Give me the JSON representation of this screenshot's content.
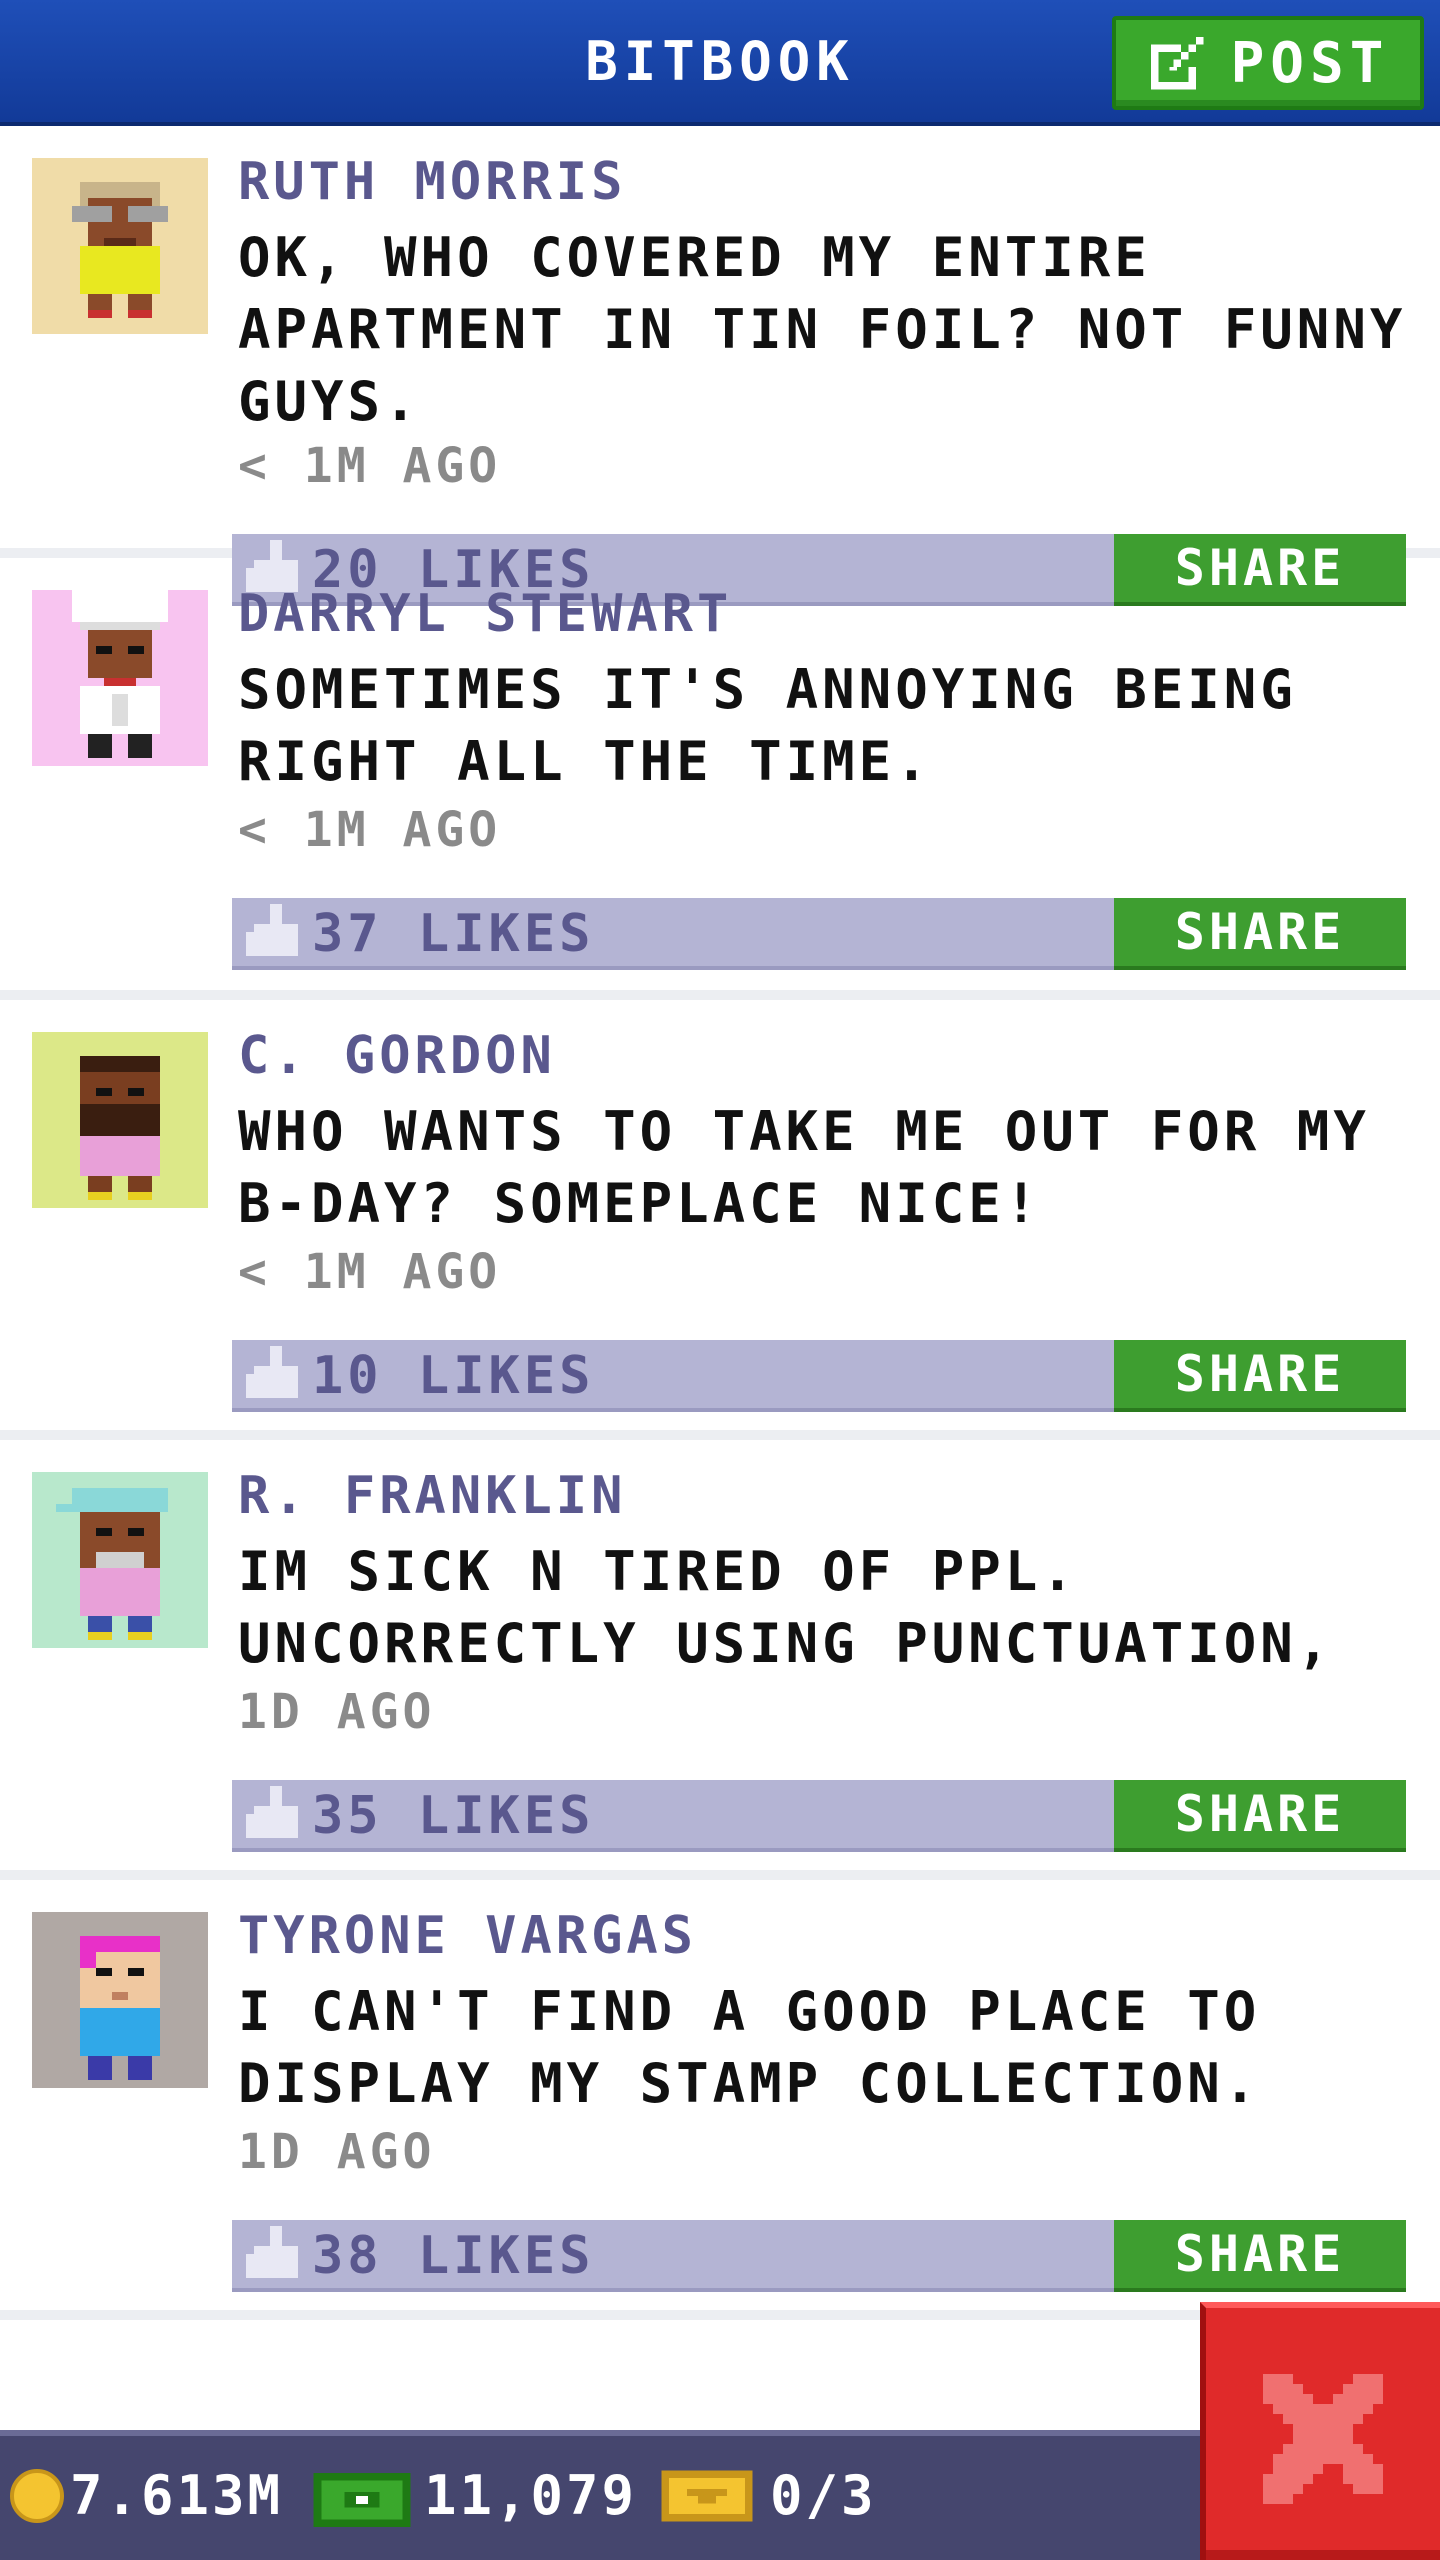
{
  "header": {
    "title": "BITBOOK",
    "post_label": "POST"
  },
  "posts": [
    {
      "name": "RUTH MORRIS",
      "text": "OK, WHO COVERED MY ENTIRE APARTMENT IN TIN FOIL? NOT FUNNY GUYS.",
      "time": "< 1M AGO",
      "likes": "20 LIKES",
      "share": "SHARE",
      "avatar_bg": "#f0dca8"
    },
    {
      "name": "DARRYL STEWART",
      "text": "SOMETIMES IT'S ANNOYING BEING RIGHT ALL THE TIME.",
      "time": "< 1M AGO",
      "likes": "37 LIKES",
      "share": "SHARE",
      "avatar_bg": "#f8c4f0"
    },
    {
      "name": "C. GORDON",
      "text": "WHO WANTS TO TAKE ME OUT FOR MY B-DAY? SOMEPLACE NICE!",
      "time": "< 1M AGO",
      "likes": "10 LIKES",
      "share": "SHARE",
      "avatar_bg": "#dce888"
    },
    {
      "name": "R. FRANKLIN",
      "text": "IM SICK N TIRED OF PPL. UNCORRECTLY USING PUNCTUATION,",
      "time": "1D AGO",
      "likes": "35 LIKES",
      "share": "SHARE",
      "avatar_bg": "#b8e8cc"
    },
    {
      "name": "TYRONE VARGAS",
      "text": "I CAN'T FIND A GOOD PLACE TO DISPLAY MY STAMP COLLECTION.",
      "time": "1D AGO",
      "likes": "38 LIKES",
      "share": "SHARE",
      "avatar_bg": "#b0a8a4"
    }
  ],
  "footer": {
    "coins": "7.613M",
    "bux": "11,079",
    "tickets": "0/3"
  },
  "colors": {
    "header_blue": "#1f4fb8",
    "share_green": "#3e9e30",
    "likes_bar": "#b4b4d4",
    "close_red": "#e02a2a"
  }
}
